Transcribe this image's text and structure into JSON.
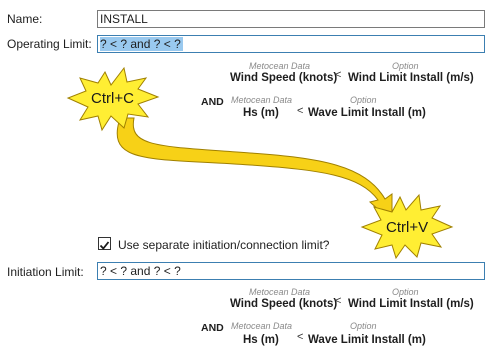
{
  "form": {
    "name_label": "Name:",
    "name_value": "INSTALL",
    "operating_label": "Operating Limit:",
    "operating_value": "? < ? and ? < ?",
    "checkbox_label": "Use separate initiation/connection limit?",
    "checkbox_checked": true,
    "initiation_label": "Initiation Limit:",
    "initiation_value": "? < ? and ? < ?"
  },
  "operating_expr": {
    "row1": {
      "left_caption": "Metocean Data",
      "left_value": "Wind Speed (knots)",
      "operator": "<",
      "right_caption": "Option",
      "right_value": "Wind Limit Install (m/s)"
    },
    "and_label": "AND",
    "row2": {
      "left_caption": "Metocean Data",
      "left_value": "Hs (m)",
      "operator": "<",
      "right_caption": "Option",
      "right_value": "Wave Limit Install (m)"
    }
  },
  "initiation_expr": {
    "row1": {
      "left_caption": "Metocean Data",
      "left_value": "Wind Speed (knots)",
      "operator": "<",
      "right_caption": "Option",
      "right_value": "Wind Limit Install (m/s)"
    },
    "and_label": "AND",
    "row2": {
      "left_caption": "Metocean Data",
      "left_value": "Hs (m)",
      "operator": "<",
      "right_caption": "Option",
      "right_value": "Wave Limit Install (m)"
    }
  },
  "annotations": {
    "copy_label": "Ctrl+C",
    "paste_label": "Ctrl+V",
    "burst_fill": "#ffee33",
    "arrow_fill": "#f7d117",
    "selection_color": "#99c9ef"
  }
}
